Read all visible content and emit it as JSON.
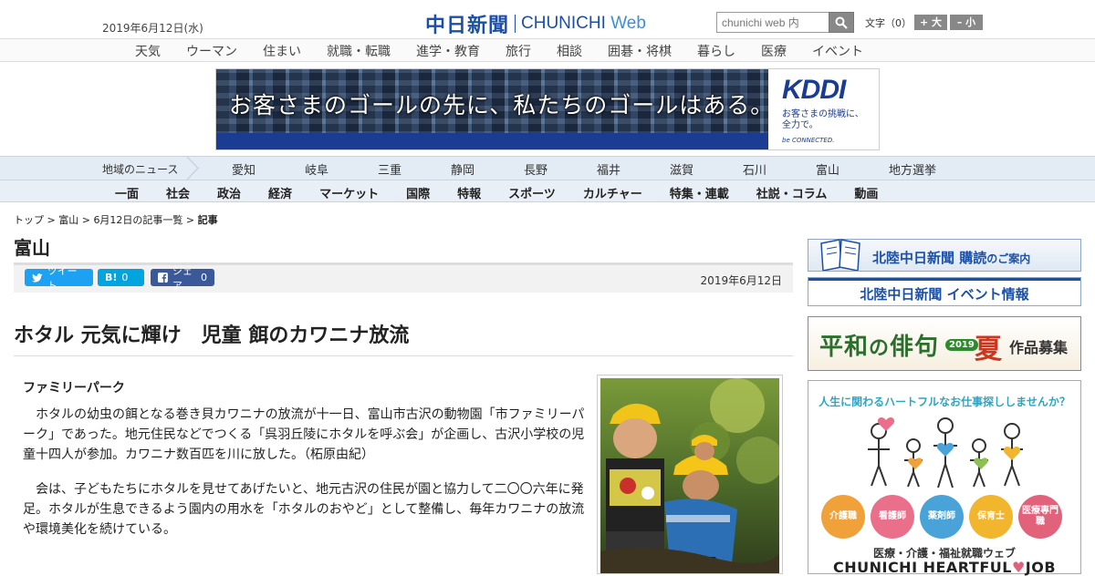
{
  "header": {
    "date": "2019年6月12日(水)",
    "logo_jp": "中日新聞",
    "logo_en_main": "CHUNICHI",
    "logo_en_sub": "Web",
    "search_placeholder": "chunichi web 内",
    "fontsize_label": "文字（0）",
    "fontsize_plus": "+ 大",
    "fontsize_minus": "– 小"
  },
  "topnav": [
    "天気",
    "ウーマン",
    "住まい",
    "就職・転職",
    "進学・教育",
    "旅行",
    "相談",
    "囲碁・将棋",
    "暮らし",
    "医療",
    "イベント"
  ],
  "banner": {
    "copy": "お客さまのゴールの先に、私たちのゴールはある。",
    "brand": "KDDI",
    "sub": "お客さまの挑戦に、全力で。",
    "tag": "be CONNECTED."
  },
  "regionnav": {
    "label": "地域のニュース",
    "items": [
      "愛知",
      "岐阜",
      "三重",
      "静岡",
      "長野",
      "福井",
      "滋賀",
      "石川",
      "富山",
      "地方選挙"
    ]
  },
  "catnav": [
    "一面",
    "社会",
    "政治",
    "経済",
    "マーケット",
    "国際",
    "特報",
    "スポーツ",
    "カルチャー",
    "特集・連載",
    "社説・コラム",
    "動画"
  ],
  "breadcrumb": {
    "top": "トップ",
    "region": "富山",
    "list": "6月12日の記事一覧",
    "current": "記事",
    "sep": " > "
  },
  "section_title": "富山",
  "share": {
    "tweet": "ツイート",
    "hatena_count": "0",
    "fb_label": "シェア",
    "fb_count": "0",
    "date": "2019年6月12日"
  },
  "article": {
    "headline": "ホタル 元気に輝け　児童 餌のカワニナ放流",
    "subhead": "ファミリーパーク",
    "paragraphs": [
      "ホタルの幼虫の餌となる巻き貝カワニナの放流が十一日、富山市古沢の動物園「市ファミリーパーク」であった。地元住民などでつくる「呉羽丘陵にホタルを呼ぶ会」が企画し、古沢小学校の児童十四人が参加。カワニナ数百匹を川に放した。（柘原由紀）",
      "会は、子どもたちにホタルを見せてあげたいと、地元古沢の住民が園と協力して二〇〇六年に発足。ホタルが生息できるよう園内の用水を「ホタルのおやど」として整備し、毎年カワニナの放流や環境美化を続けている。"
    ]
  },
  "sidebar": {
    "ad1": {
      "main": "北陸中日新聞 購読",
      "small": "のご案内"
    },
    "ad2": "北陸中日新聞 イベント情報",
    "ad3": {
      "main_a": "平和",
      "main_no": "の",
      "main_b": "俳句",
      "year": "2019",
      "summer": "夏",
      "tail": "作品募集"
    },
    "ad4": {
      "head": "人生に関わるハートフルなお仕事探ししませんか？",
      "circles": [
        {
          "label": "介護職",
          "color": "#f0a13a"
        },
        {
          "label": "看護師",
          "color": "#ea6f8a"
        },
        {
          "label": "薬剤師",
          "color": "#4aa3d8"
        },
        {
          "label": "保育士",
          "color": "#f1b52e"
        },
        {
          "label": "医療専門職",
          "color": "#e2627b"
        }
      ],
      "sub": "医療・介護・福祉就職ウェブ",
      "brand_a": "CHUNICHI HEARTFUL",
      "brand_heart": "♥",
      "brand_b": "JOB"
    }
  },
  "colors": {
    "brand_blue": "#1b4fa8",
    "twitter": "#1da1f2",
    "hatena": "#00a4de",
    "facebook": "#3b5998"
  }
}
